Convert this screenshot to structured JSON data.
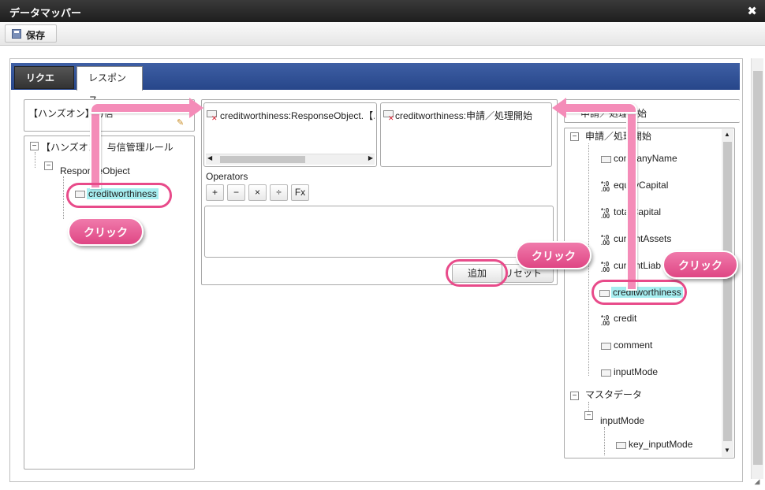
{
  "window": {
    "title": "データマッパー",
    "close": "✖"
  },
  "toolbar": {
    "save_label": "保存"
  },
  "tabs": [
    {
      "label": "リクエスト"
    },
    {
      "label": "レスポンス"
    }
  ],
  "left": {
    "header": "【ハンズオン】与信",
    "tree": {
      "root": "【ハンズオン】与信管理ルール",
      "child": "ResponseObject",
      "leaf": "creditworthiness"
    }
  },
  "middle": {
    "source_box": "creditworthiness:ResponseObject.【ハ",
    "target_box": "creditworthiness:申請／処理開始",
    "operators_label": "Operators",
    "operators": [
      "+",
      "−",
      "×",
      "÷",
      "Fx"
    ],
    "add_button": "追加",
    "reset_button": "リセット"
  },
  "right": {
    "header": "申請／処理開始",
    "tree": {
      "root": "申請／処理開始",
      "items": [
        {
          "label": "companyName",
          "icon": "node-icon"
        },
        {
          "label": "equityCapital",
          "icon": "number-icon"
        },
        {
          "label": "totalCapital",
          "icon": "number-icon"
        },
        {
          "label": "currentAssets",
          "icon": "number-icon"
        },
        {
          "label": "currentLiabilities",
          "icon": "number-icon"
        },
        {
          "label": "creditworthiness",
          "icon": "node-icon"
        },
        {
          "label": "credit",
          "icon": "number-icon"
        },
        {
          "label": "comment",
          "icon": "node-icon"
        },
        {
          "label": "inputMode",
          "icon": "node-icon"
        }
      ],
      "master": "マスタデータ",
      "master_child": "inputMode",
      "master_leaf": "key_inputMode"
    }
  },
  "callouts": {
    "click1": "クリック",
    "click2": "クリック",
    "click3": "クリック"
  },
  "colors": {
    "accent": "#e84b8a",
    "tabbar": "#2f4e93",
    "highlight": "#a6eef0"
  }
}
